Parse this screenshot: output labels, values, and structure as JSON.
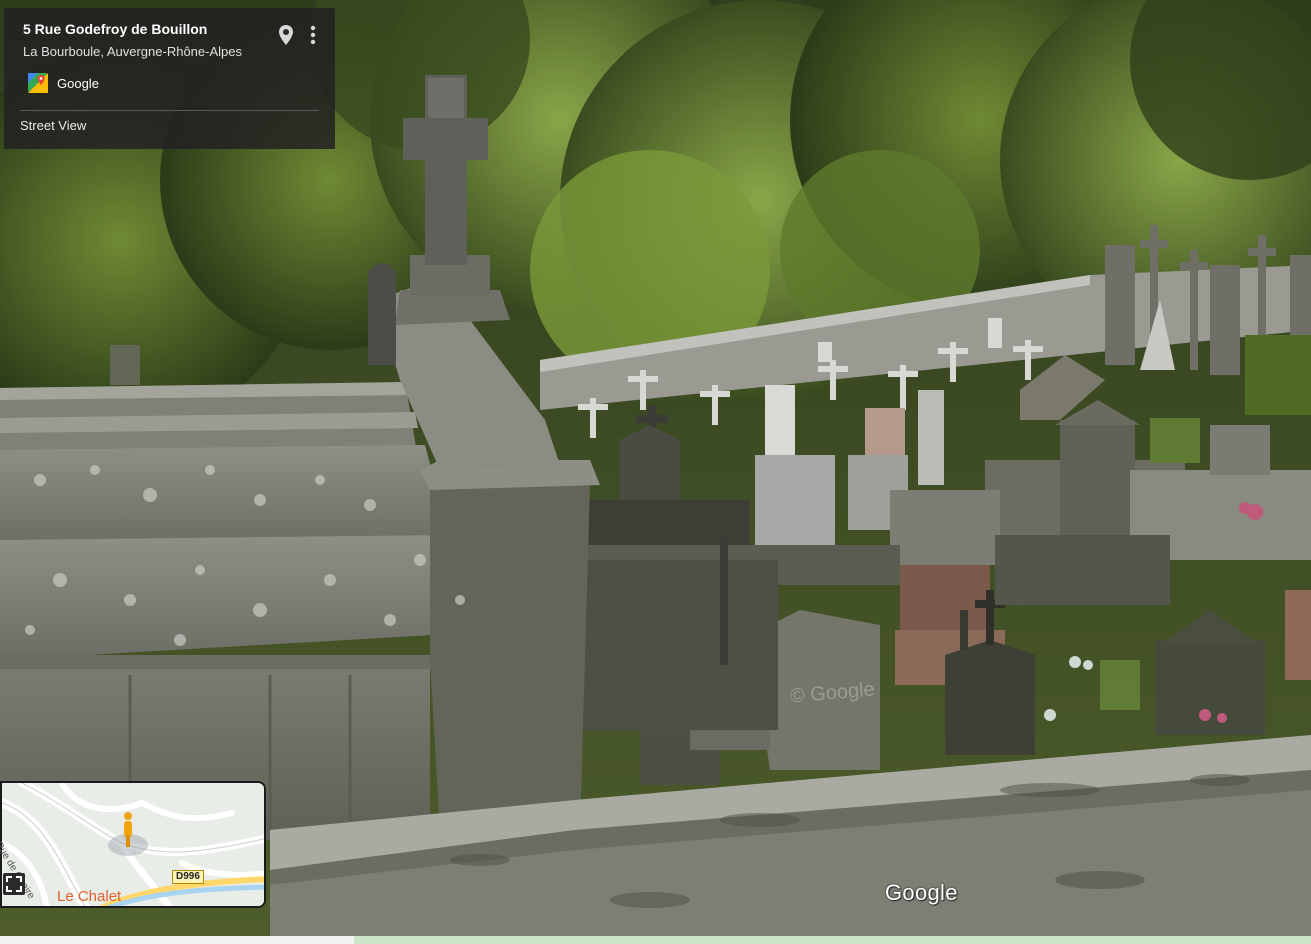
{
  "info_card": {
    "title": "5 Rue Godefroy de Bouillon",
    "subtitle": "La Bourboule, Auvergne-Rhône-Alpes",
    "brand": "Google",
    "footer": "Street View",
    "icons": [
      "location-pin-icon",
      "more-vert-icon",
      "google-maps-logo"
    ]
  },
  "minimap": {
    "road_label": "Rue de Quaire",
    "route_badge": "D996",
    "place_label": "Le Chalet",
    "icons": [
      "pegman-icon",
      "expand-icon"
    ]
  },
  "watermarks": {
    "main": "Google",
    "image_watermark": "© Google"
  },
  "colors": {
    "accent_place": "#e0612c",
    "pegman": "#f2a20c",
    "card_bg": "#222222"
  }
}
